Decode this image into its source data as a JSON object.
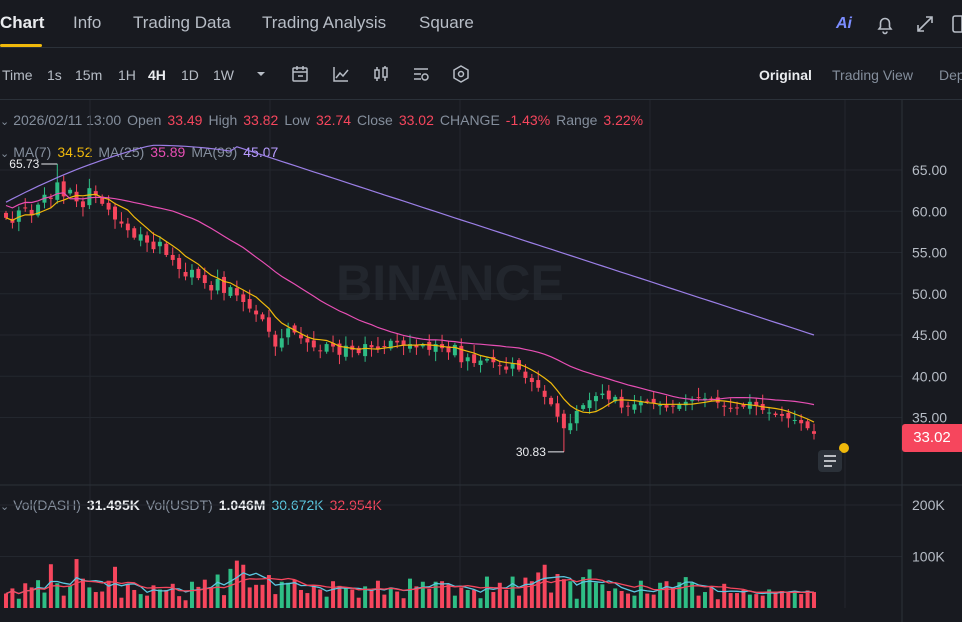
{
  "nav": {
    "tabs": [
      {
        "label": "Chart"
      },
      {
        "label": "Info"
      },
      {
        "label": "Trading Data"
      },
      {
        "label": "Trading Analysis"
      },
      {
        "label": "Square"
      }
    ],
    "ai_label": "Ai"
  },
  "toolbar": {
    "intervals": [
      "Time",
      "1s",
      "15m",
      "1H",
      "4H",
      "1D",
      "1W"
    ],
    "active_interval": "4H",
    "views": [
      "Original",
      "Trading View",
      "Dep"
    ]
  },
  "ohlc": {
    "date": "2026/02/11 13:00",
    "open_label": "Open",
    "open": "33.49",
    "high_label": "High",
    "high": "33.82",
    "low_label": "Low",
    "low": "32.74",
    "close_label": "Close",
    "close": "33.02",
    "change_label": "CHANGE",
    "change": "-1.43%",
    "range_label": "Range",
    "range": "3.22%"
  },
  "ma": {
    "ma7_label": "MA(7)",
    "ma7": "34.52",
    "ma25_label": "MA(25)",
    "ma25": "35.89",
    "ma99_label": "MA(99)",
    "ma99": "45.07"
  },
  "vol": {
    "dash_label": "Vol(DASH)",
    "dash": "31.495K",
    "usdt_label": "Vol(USDT)",
    "usdt": "1.046M",
    "ma1": "30.672K",
    "ma2": "32.954K"
  },
  "watermark": "BINANCE",
  "current_price": "33.02",
  "colors": {
    "up": "#2ebd85",
    "down": "#f6465d",
    "ma7": "#f0b90b",
    "ma25": "#e84fb5",
    "ma99": "#9b7fe6",
    "accent": "#f0b90b"
  },
  "chart_data": {
    "type": "candlestick",
    "price_axis": {
      "ticks": [
        "65.00",
        "60.00",
        "55.00",
        "50.00",
        "45.00",
        "40.00",
        "35.00"
      ],
      "range": [
        30,
        68
      ]
    },
    "volume_axis": {
      "ticks": [
        "200K",
        "100K"
      ]
    },
    "high_marker": {
      "label": "65.73",
      "value": 65.73
    },
    "low_marker": {
      "label": "30.83",
      "value": 30.83
    },
    "closes": [
      59.2,
      58.6,
      60.1,
      60.4,
      59.5,
      60.8,
      62.0,
      61.5,
      63.5,
      61.8,
      62.6,
      61.2,
      60.5,
      62.8,
      61.9,
      60.9,
      60.2,
      59.0,
      58.5,
      57.7,
      56.8,
      57.2,
      56.2,
      55.4,
      56.3,
      54.7,
      54.1,
      53.0,
      52.1,
      52.9,
      51.9,
      51.3,
      50.4,
      51.8,
      50.1,
      50.8,
      49.8,
      49.0,
      48.2,
      47.5,
      46.9,
      45.4,
      43.6,
      44.6,
      45.8,
      45.3,
      44.6,
      44.1,
      43.5,
      43.1,
      43.9,
      43.6,
      42.6,
      43.7,
      43.2,
      42.8,
      43.9,
      43.5,
      43.3,
      43.6,
      44.3,
      44.1,
      43.7,
      43.9,
      43.5,
      43.8,
      43.2,
      43.9,
      43.4,
      42.9,
      43.8,
      41.7,
      42.3,
      41.6,
      41.9,
      42.1,
      41.7,
      41.3,
      40.8,
      41.6,
      40.8,
      39.8,
      39.3,
      38.6,
      37.5,
      36.6,
      35.1,
      33.7,
      34.3,
      35.8,
      36.5,
      37.1,
      37.6,
      37.9,
      37.2,
      37.5,
      36.2,
      36.3,
      36.6,
      36.9,
      36.9,
      36.7,
      36.5,
      36.2,
      36.4,
      36.6,
      36.9,
      37.1,
      37.4,
      37.3,
      37.2,
      36.8,
      36.3,
      36.1,
      36.2,
      36.3,
      36.9,
      36.4,
      35.9,
      35.6,
      35.3,
      35.2,
      34.9,
      34.7,
      34.3,
      33.7,
      33.02
    ],
    "volumes": [
      28,
      38,
      18,
      48,
      40,
      54,
      30,
      85,
      48,
      24,
      43,
      95,
      57,
      40,
      31,
      32,
      53,
      80,
      20,
      46,
      35,
      27,
      24,
      44,
      36,
      35,
      47,
      23,
      15,
      51,
      41,
      55,
      38,
      65,
      25,
      76,
      92,
      84,
      40,
      45,
      45,
      64,
      27,
      51,
      49,
      55,
      35,
      29,
      42,
      36,
      22,
      52,
      43,
      39,
      36,
      20,
      42,
      34,
      53,
      26,
      40,
      32,
      19,
      57,
      42,
      51,
      37,
      51,
      52,
      46,
      24,
      40,
      35,
      35,
      19,
      61,
      31,
      49,
      35,
      61,
      24,
      59,
      52,
      69,
      84,
      30,
      66,
      56,
      52,
      18,
      60,
      75,
      49,
      46,
      33,
      38,
      33,
      28,
      24,
      53,
      28,
      26,
      49,
      52,
      40,
      50,
      60,
      49,
      24,
      31,
      40,
      17,
      47,
      29,
      29,
      35,
      26,
      27,
      24,
      36,
      32,
      33,
      30,
      32,
      27,
      34,
      31
    ]
  }
}
